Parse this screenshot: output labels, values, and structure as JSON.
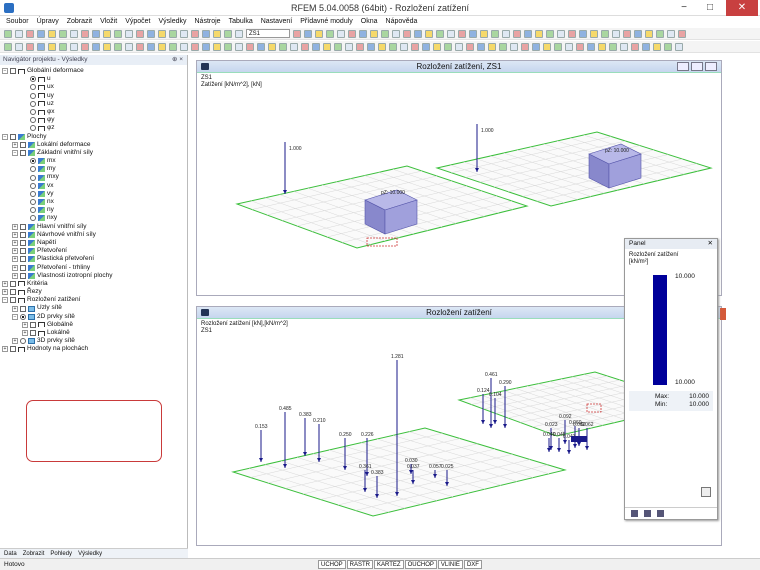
{
  "app": {
    "title": "RFEM 5.04.0058 (64bit) - Rozložení zatížení",
    "min": "−",
    "max": "□",
    "close": "✕"
  },
  "menu": [
    "Soubor",
    "Úpravy",
    "Zobrazit",
    "Vložit",
    "Výpočet",
    "Výsledky",
    "Nástroje",
    "Tabulka",
    "Nastavení",
    "Přídavné moduly",
    "Okna",
    "Nápověda"
  ],
  "toolbar": {
    "loadcase": "ZS1"
  },
  "navigator": {
    "title": "Navigátor projektu - Výsledky",
    "items": [
      {
        "t": "Globální deformace",
        "i": 0,
        "ex": "−",
        "c": "chk",
        "ic": "fold"
      },
      {
        "t": "u",
        "i": 2,
        "c": "rad on",
        "ic": "fold"
      },
      {
        "t": "ux",
        "i": 2,
        "c": "rad",
        "ic": "fold"
      },
      {
        "t": "uy",
        "i": 2,
        "c": "rad",
        "ic": "fold"
      },
      {
        "t": "uz",
        "i": 2,
        "c": "rad",
        "ic": "fold"
      },
      {
        "t": "φx",
        "i": 2,
        "c": "rad",
        "ic": "fold"
      },
      {
        "t": "φy",
        "i": 2,
        "c": "rad",
        "ic": "fold"
      },
      {
        "t": "φz",
        "i": 2,
        "c": "rad",
        "ic": "fold"
      },
      {
        "t": "Plochy",
        "i": 0,
        "ex": "−",
        "c": "chk",
        "ic": "surf"
      },
      {
        "t": "Lokální deformace",
        "i": 1,
        "ex": "+",
        "c": "chk",
        "ic": "surf"
      },
      {
        "t": "Základní vnitřní síly",
        "i": 1,
        "ex": "−",
        "c": "chk",
        "ic": "surf"
      },
      {
        "t": "mx",
        "i": 2,
        "c": "rad on",
        "ic": "surf"
      },
      {
        "t": "my",
        "i": 2,
        "c": "rad",
        "ic": "surf"
      },
      {
        "t": "mxy",
        "i": 2,
        "c": "rad",
        "ic": "surf"
      },
      {
        "t": "vx",
        "i": 2,
        "c": "rad",
        "ic": "surf"
      },
      {
        "t": "vy",
        "i": 2,
        "c": "rad",
        "ic": "surf"
      },
      {
        "t": "nx",
        "i": 2,
        "c": "rad",
        "ic": "surf"
      },
      {
        "t": "ny",
        "i": 2,
        "c": "rad",
        "ic": "surf"
      },
      {
        "t": "nxy",
        "i": 2,
        "c": "rad",
        "ic": "surf"
      },
      {
        "t": "Hlavní vnitřní síly",
        "i": 1,
        "ex": "+",
        "c": "chk",
        "ic": "surf"
      },
      {
        "t": "Návrhové vnitřní síly",
        "i": 1,
        "ex": "+",
        "c": "chk",
        "ic": "surf"
      },
      {
        "t": "Napětí",
        "i": 1,
        "ex": "+",
        "c": "chk",
        "ic": "surf"
      },
      {
        "t": "Přetvoření",
        "i": 1,
        "ex": "+",
        "c": "chk",
        "ic": "surf"
      },
      {
        "t": "Plastická přetvoření",
        "i": 1,
        "ex": "+",
        "c": "chk",
        "ic": "surf"
      },
      {
        "t": "Přetvoření - trhliny",
        "i": 1,
        "ex": "+",
        "c": "chk",
        "ic": "surf"
      },
      {
        "t": "Vlastnosti izotropní plochy",
        "i": 1,
        "ex": "+",
        "c": "chk",
        "ic": "surf"
      },
      {
        "t": "Kritéria",
        "i": 0,
        "ex": "+",
        "c": "chk",
        "ic": "fold"
      },
      {
        "t": "Řezy",
        "i": 0,
        "ex": "+",
        "c": "chk",
        "ic": "fold"
      },
      {
        "t": "Rozložení zatížení",
        "i": 0,
        "ex": "−",
        "c": "chk",
        "ic": "fold"
      },
      {
        "t": "Uzly sítě",
        "i": 1,
        "ex": "+",
        "c": "chk",
        "ic": "mesh"
      },
      {
        "t": "2D prvky sítě",
        "i": 1,
        "ex": "−",
        "c": "rad on",
        "ic": "mesh"
      },
      {
        "t": "Globálně",
        "i": 2,
        "ex": "+",
        "c": "chk",
        "ic": "fold"
      },
      {
        "t": "Lokálně",
        "i": 2,
        "ex": "+",
        "c": "chk",
        "ic": "fold"
      },
      {
        "t": "3D prvky sítě",
        "i": 1,
        "ex": "+",
        "c": "rad",
        "ic": "mesh"
      },
      {
        "t": "Hodnoty na plochách",
        "i": 0,
        "ex": "+",
        "c": "chk",
        "ic": "fold"
      }
    ],
    "tabs": [
      "Data",
      "Zobrazit",
      "Pohledy",
      "Výsledky"
    ]
  },
  "view1": {
    "title": "Rozložení zatížení, ZS1",
    "line1": "ZS1",
    "line2": "Zatížení [kN/m^2], [kN]",
    "labels": [
      "1.000",
      "1.000",
      "pZ: 10.000",
      "pZ: 10.000"
    ]
  },
  "view2": {
    "title": "Rozložení zatížení",
    "line1": "Rozložení zatížení [kN],[kN/m^2]",
    "line2": "ZS1",
    "labels": [
      "1.281",
      "0.485",
      "0.383",
      "0.210",
      "0.153",
      "0.250",
      "0.226",
      "0.030",
      "0.057",
      "0.037",
      "0.025",
      "0.361",
      "0.383",
      "0.461",
      "0.290",
      "0.124",
      "0.104",
      "0.023",
      "0.092",
      "0.060",
      "0.062",
      "0.082",
      "0.045",
      "0.040",
      "0.043"
    ]
  },
  "panel": {
    "title": "Panel",
    "subtitle1": "Rozložení zatížení",
    "subtitle2": "[kN/m²]",
    "top": "10.000",
    "bottom": "10.000",
    "max_label": "Max:",
    "max": "10.000",
    "min_label": "Min:",
    "min": "10.000",
    "close": "✕"
  },
  "status": {
    "text": "Hotovo",
    "tabs": [
      "UCHOP",
      "RASTR",
      "KARTEZ",
      "OUCHOP",
      "VLINIE",
      "DXF"
    ]
  }
}
